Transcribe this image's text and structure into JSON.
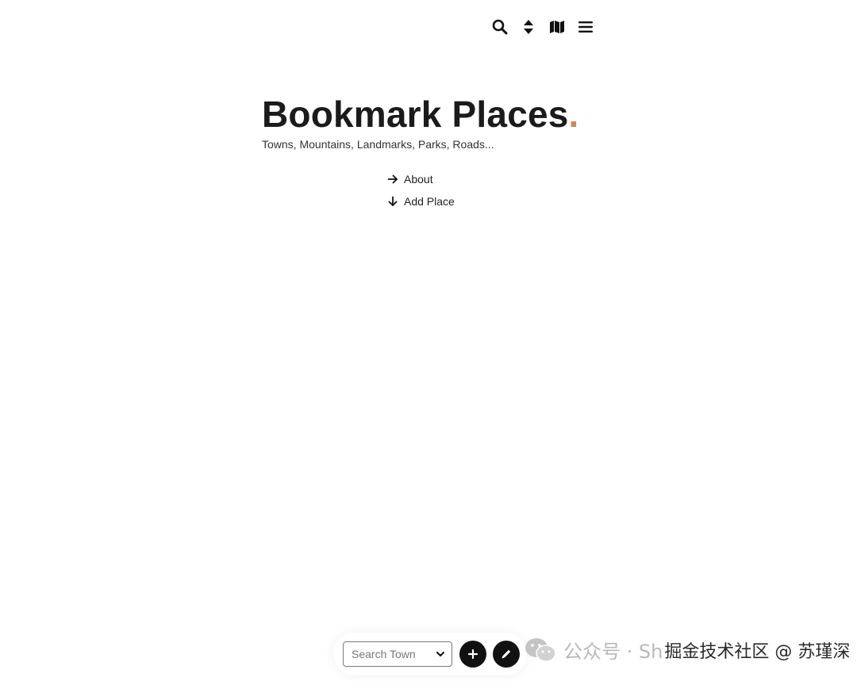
{
  "toolbar": {
    "icons": [
      "search-icon",
      "sort-icon",
      "map-icon",
      "menu-icon"
    ]
  },
  "hero": {
    "title": "Bookmark Places",
    "title_dot": ".",
    "subtitle": "Towns, Mountains, Landmarks, Parks, Roads..."
  },
  "links": {
    "about": "About",
    "add_place": "Add Place"
  },
  "bottom_bar": {
    "search_placeholder": "Search Town"
  },
  "watermark": {
    "left": "公众号 · Sh",
    "right": "掘金技术社区 @ 苏瑾深"
  },
  "colors": {
    "accent": "#d4874a",
    "text": "#1b1b1b",
    "button": "#111111"
  }
}
